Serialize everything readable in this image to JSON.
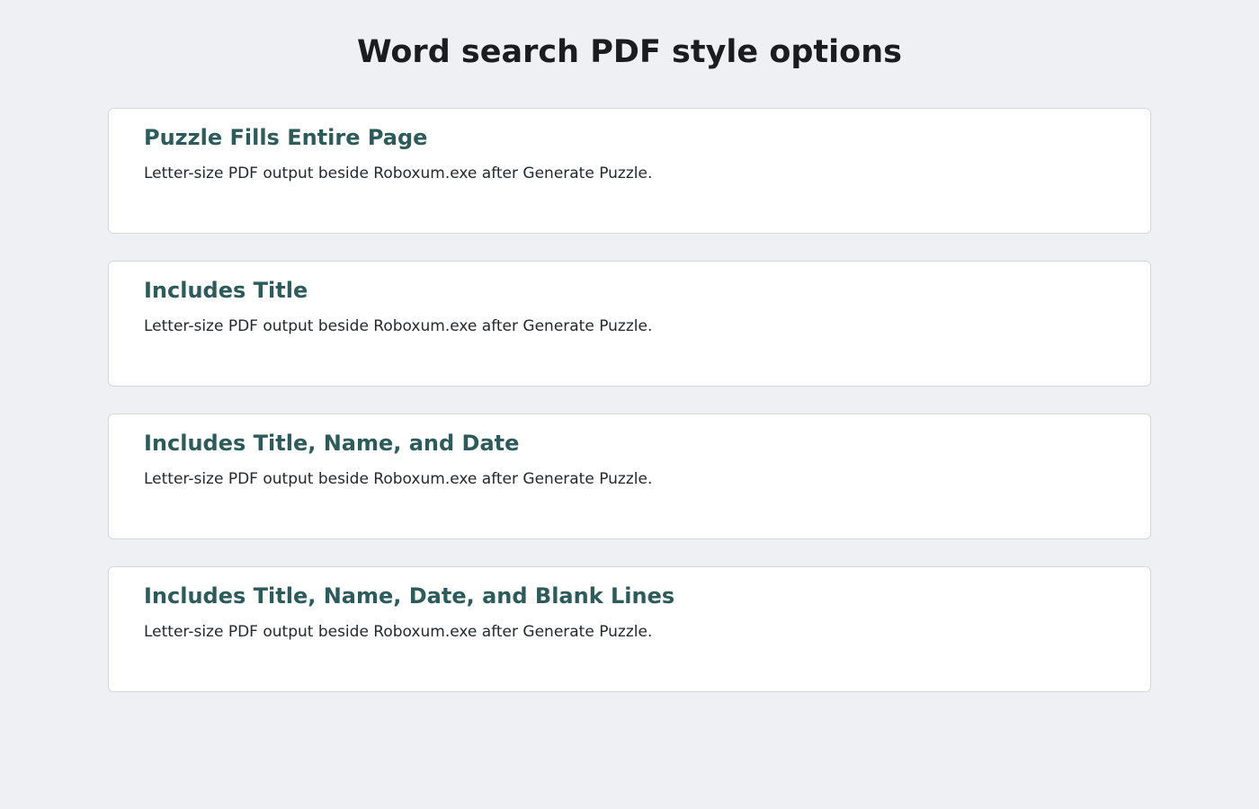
{
  "page": {
    "title": "Word search PDF style options"
  },
  "options": [
    {
      "title": "Puzzle Fills Entire Page",
      "description": "Letter-size PDF output beside Roboxum.exe after Generate Puzzle."
    },
    {
      "title": "Includes Title",
      "description": "Letter-size PDF output beside Roboxum.exe after Generate Puzzle."
    },
    {
      "title": "Includes Title, Name, and Date",
      "description": "Letter-size PDF output beside Roboxum.exe after Generate Puzzle."
    },
    {
      "title": "Includes Title, Name, Date, and Blank Lines",
      "description": "Letter-size PDF output beside Roboxum.exe after Generate Puzzle."
    }
  ],
  "colors": {
    "background": "#eff0f4",
    "card": "#ffffff",
    "card_border": "#d6d8dd",
    "option_title": "#2d5a5a",
    "text": "#25282b"
  }
}
